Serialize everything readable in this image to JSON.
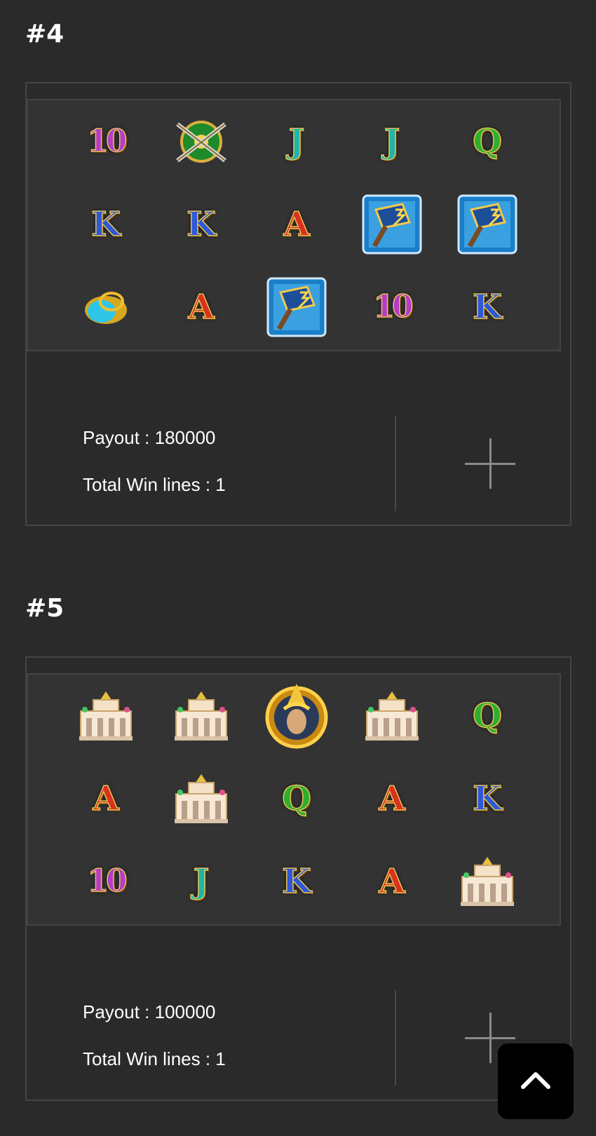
{
  "sections": [
    {
      "title": "#4",
      "grid": [
        [
          "10",
          "swords-shield",
          "J",
          "J",
          "Q"
        ],
        [
          "K",
          "K",
          "A",
          "hammer-scatter",
          "hammer-scatter"
        ],
        [
          "cauldron",
          "A",
          "hammer-scatter",
          "10",
          "K"
        ]
      ],
      "payout_text": "Payout : 180000",
      "win_lines_text": "Total Win lines : 1",
      "expand_icon": "plus-icon"
    },
    {
      "title": "#5",
      "grid": [
        [
          "temple",
          "temple",
          "warrior-medallion",
          "temple",
          "Q"
        ],
        [
          "A",
          "temple",
          "Q",
          "A",
          "K"
        ],
        [
          "10",
          "J",
          "K",
          "A",
          "temple"
        ]
      ],
      "payout_text": "Payout : 100000",
      "win_lines_text": "Total Win lines : 1",
      "expand_icon": "plus-icon"
    }
  ],
  "scroll_top_icon": "chevron-up-icon",
  "colors": {
    "background": "#2a2a2a",
    "board": "#333333",
    "border": "#444444",
    "button": "#000000"
  }
}
